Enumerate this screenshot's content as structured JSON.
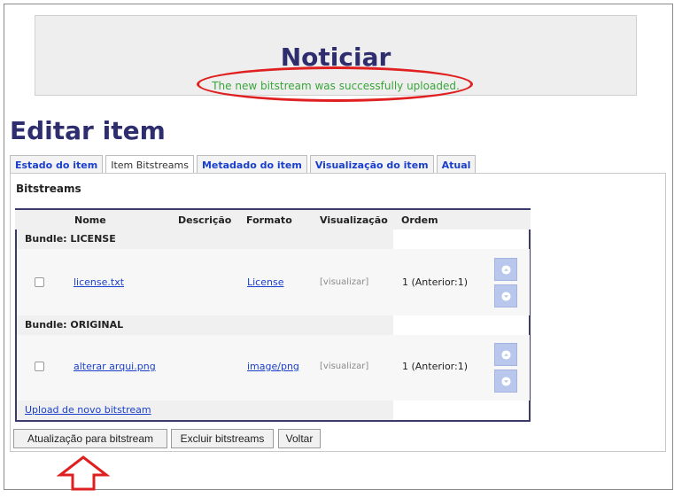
{
  "notice": {
    "title": "Noticiar",
    "message": "The new bitstream was successfully uploaded."
  },
  "page_title": "Editar item",
  "tabs": [
    {
      "label": "Estado do item",
      "active": false
    },
    {
      "label": "Item Bitstreams",
      "active": true
    },
    {
      "label": "Metadado do item",
      "active": false
    },
    {
      "label": "Visualização do item",
      "active": false
    },
    {
      "label": "Atual",
      "active": false
    }
  ],
  "section_heading": "Bitstreams",
  "table": {
    "headers": {
      "nome": "Nome",
      "descricao": "Descrição",
      "formato": "Formato",
      "visualizacao": "Visualização",
      "ordem": "Ordem"
    },
    "bundles": [
      {
        "label": "Bundle: LICENSE",
        "item": {
          "name": "license.txt",
          "format": "License",
          "view": "[visualizar]",
          "order": "1 (Anterior:1)"
        }
      },
      {
        "label": "Bundle: ORIGINAL",
        "item": {
          "name": "alterar arqui.png",
          "format": "image/png",
          "view": "[visualizar]",
          "order": "1 (Anterior:1)"
        }
      }
    ],
    "upload_link": "Upload de novo bitstream"
  },
  "buttons": {
    "update": "Atualização para bitstream",
    "delete": "Excluir bitstreams",
    "back": "Voltar"
  },
  "colors": {
    "title": "#2e2e6e",
    "success": "#3aa53a",
    "link": "#1a3fcc",
    "highlight": "#e02020",
    "arrow_button": "#b9c7ec"
  },
  "icons": {
    "up": "arrow-up-icon",
    "down": "arrow-down-icon",
    "annotation": "annotation-arrow-icon"
  }
}
